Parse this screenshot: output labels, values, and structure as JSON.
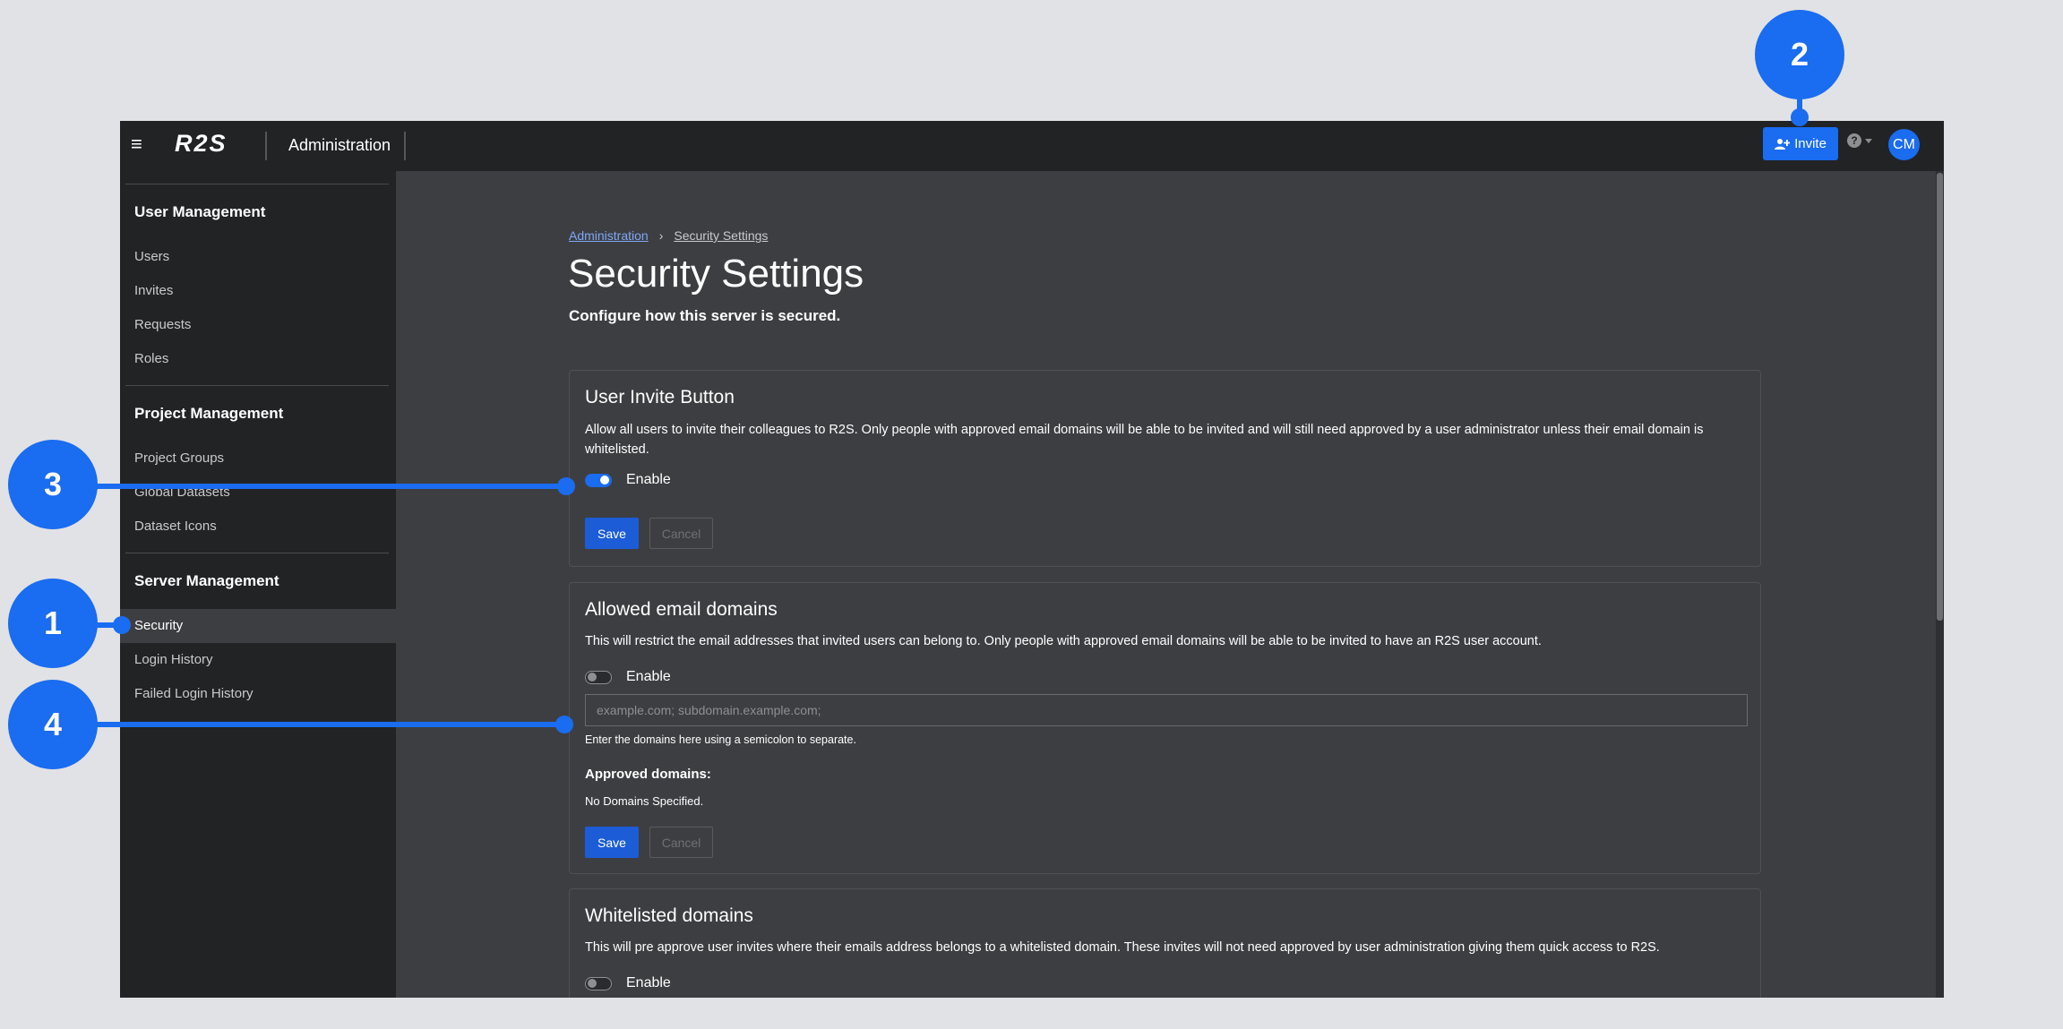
{
  "topbar": {
    "logo": "R2S",
    "title": "Administration",
    "invite_label": "Invite",
    "help_glyph": "?",
    "avatar_initials": "CM"
  },
  "sidebar": {
    "sections": [
      {
        "heading": "User Management",
        "items": [
          "Users",
          "Invites",
          "Requests",
          "Roles"
        ]
      },
      {
        "heading": "Project Management",
        "items": [
          "Project Groups",
          "Global Datasets",
          "Dataset Icons"
        ]
      },
      {
        "heading": "Server Management",
        "items": [
          "Security",
          "Login History",
          "Failed Login History"
        ]
      }
    ],
    "active_item": "Security"
  },
  "breadcrumb": {
    "parent": "Administration",
    "separator": "›",
    "current": "Security Settings"
  },
  "page": {
    "title": "Security Settings",
    "subtitle": "Configure how this server is secured."
  },
  "cards": {
    "invite_button": {
      "title": "User Invite Button",
      "description": "Allow all users to invite their colleagues to R2S. Only people with approved email domains will be able to be invited and will still need approved by a user administrator unless their email domain is whitelisted.",
      "toggle_label": "Enable",
      "enabled": true,
      "save_label": "Save",
      "cancel_label": "Cancel"
    },
    "allowed_domains": {
      "title": "Allowed email domains",
      "description": "This will restrict the email addresses that invited users can belong to. Only people with approved email domains will be able to be invited to have an R2S user account.",
      "toggle_label": "Enable",
      "enabled": false,
      "input_placeholder": "example.com; subdomain.example.com;",
      "input_value": "",
      "help_text": "Enter the domains here using a semicolon to separate.",
      "approved_label": "Approved domains:",
      "approved_value": "No Domains Specified.",
      "save_label": "Save",
      "cancel_label": "Cancel"
    },
    "whitelisted_domains": {
      "title": "Whitelisted domains",
      "description": "This will pre approve user invites where their emails address belongs to a whitelisted domain. These invites will not need approved by user administration giving them quick access to R2S.",
      "toggle_label": "Enable",
      "enabled": false
    }
  },
  "callouts": [
    "1",
    "2",
    "3",
    "4"
  ],
  "colors": {
    "accent": "#1a6cf0",
    "topbar_bg": "#222325",
    "content_bg": "#3d3e42",
    "page_bg": "#e1e2e5"
  },
  "icons": {
    "menu": "hamburger-icon",
    "invite": "user-plus-icon",
    "help": "help-circle-icon",
    "help_dropdown": "chevron-down-icon"
  }
}
